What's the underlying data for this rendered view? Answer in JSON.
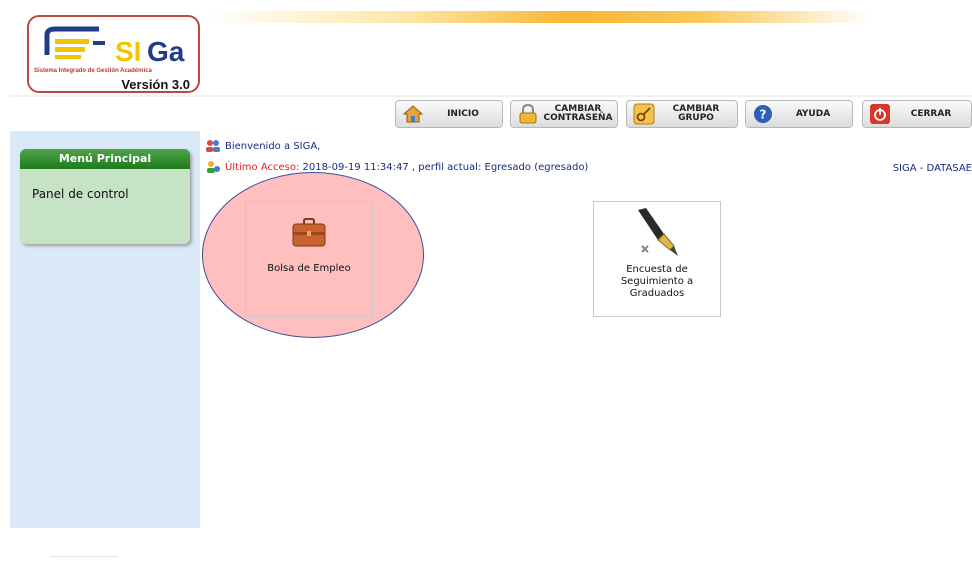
{
  "logo": {
    "brand": "SIGa",
    "subtitle": "Sistema Integrado de Gestión Académica",
    "version": "Versión 3.0"
  },
  "toolbar": {
    "buttons": [
      {
        "label": "INICIO",
        "icon": "home-icon"
      },
      {
        "label": "CAMBIAR\nCONTRASEÑA",
        "icon": "lock-icon"
      },
      {
        "label": "CAMBIAR\nGRUPO",
        "icon": "key-icon"
      },
      {
        "label": "AYUDA",
        "icon": "help-icon"
      },
      {
        "label": "CERRAR",
        "icon": "power-icon"
      }
    ]
  },
  "sidebar": {
    "menu_title": "Menú Principal",
    "items": [
      {
        "label": "Panel de control"
      }
    ]
  },
  "header": {
    "welcome": "Bienvenido a SIGA,",
    "last_access_label": "Último Acceso:",
    "last_access_value": "2018-09-19 11:34:47 , perfil actual: Egresado (egresado)",
    "system_name": "SIGA - DATASAE"
  },
  "modules": [
    {
      "title": "Bolsa de Empleo",
      "icon": "briefcase-icon"
    },
    {
      "title": "Encuesta de\nSeguimiento a\nGraduados",
      "icon": "fountain-pen-icon"
    }
  ],
  "colors": {
    "accent_orange": "#f7b733",
    "menu_green": "#2e8b2c",
    "highlight_pink": "#ffaaaa",
    "sidebar_blue": "#d9e9f8",
    "text_blue": "#1a2a80",
    "text_red": "#e02020"
  }
}
